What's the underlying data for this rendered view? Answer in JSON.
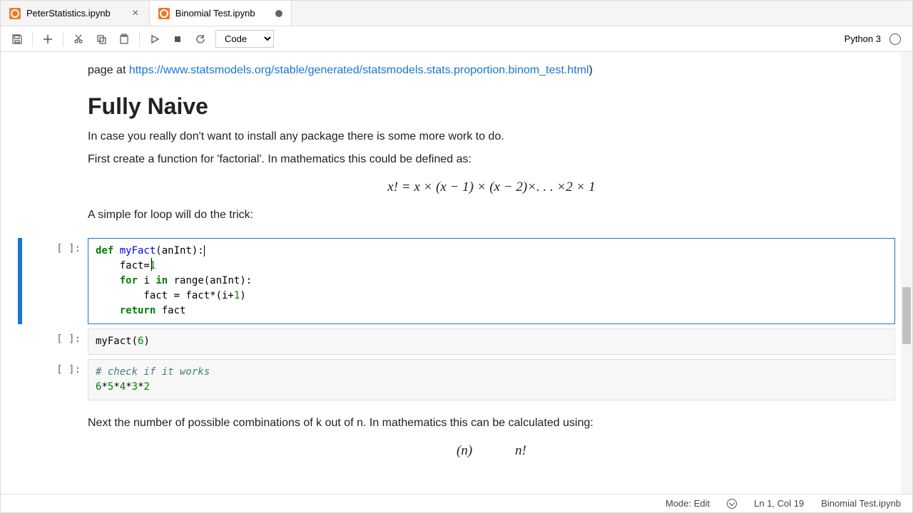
{
  "tabs": [
    {
      "label": "PeterStatistics.ipynb",
      "active": false,
      "dirty": false
    },
    {
      "label": "Binomial Test.ipynb",
      "active": true,
      "dirty": true
    }
  ],
  "toolbar": {
    "cell_type": "Code",
    "kernel_label": "Python 3"
  },
  "markdown": {
    "top_text_prefix": "page at ",
    "top_link": "https://www.statsmodels.org/stable/generated/statsmodels.stats.proportion.binom_test.html",
    "top_text_suffix": ")",
    "heading": "Fully Naive",
    "para1": "In case you really don't want to install any package there is some more work to do.",
    "para2": "First create a function for 'factorial'. In mathematics this could be defined as:",
    "formula": "x! = x × (x − 1) × (x − 2)×. . . ×2 × 1",
    "para3": "A simple for loop will do the trick:",
    "para4": "Next the number of possible combinations of k out of n. In mathematics this can be calculated using:",
    "formula2_left": "(n)",
    "formula2_right": "n!"
  },
  "cells": [
    {
      "prompt": "[ ]:",
      "active": true,
      "code_lines": [
        [
          {
            "t": "def ",
            "c": "tok-kw"
          },
          {
            "t": "myFact",
            "c": "tok-fn"
          },
          {
            "t": "(anInt):",
            "c": ""
          },
          {
            "cursor": true
          }
        ],
        [
          {
            "t": "    fact=",
            "c": ""
          },
          {
            "t": "1",
            "c": "tok-num"
          }
        ],
        [
          {
            "t": "    ",
            "c": ""
          },
          {
            "t": "for",
            "c": "tok-kw"
          },
          {
            "t": " i ",
            "c": ""
          },
          {
            "t": "in",
            "c": "tok-kw"
          },
          {
            "t": " range(anInt):",
            "c": ""
          }
        ],
        [
          {
            "t": "        fact = fact*(i+",
            "c": ""
          },
          {
            "t": "1",
            "c": "tok-num"
          },
          {
            "t": ")",
            "c": ""
          }
        ],
        [
          {
            "t": "    ",
            "c": ""
          },
          {
            "t": "return",
            "c": "tok-kw"
          },
          {
            "t": " fact",
            "c": ""
          }
        ]
      ]
    },
    {
      "prompt": "[ ]:",
      "active": false,
      "code_lines": [
        [
          {
            "t": "myFact(",
            "c": ""
          },
          {
            "t": "6",
            "c": "tok-num"
          },
          {
            "t": ")",
            "c": ""
          }
        ]
      ]
    },
    {
      "prompt": "[ ]:",
      "active": false,
      "code_lines": [
        [
          {
            "t": "# check if it works",
            "c": "tok-cmt"
          }
        ],
        [
          {
            "t": "6",
            "c": "tok-num"
          },
          {
            "t": "*",
            "c": ""
          },
          {
            "t": "5",
            "c": "tok-num"
          },
          {
            "t": "*",
            "c": ""
          },
          {
            "t": "4",
            "c": "tok-num"
          },
          {
            "t": "*",
            "c": ""
          },
          {
            "t": "3",
            "c": "tok-num"
          },
          {
            "t": "*",
            "c": ""
          },
          {
            "t": "2",
            "c": "tok-num"
          }
        ]
      ]
    }
  ],
  "statusbar": {
    "mode": "Mode: Edit",
    "cursor_pos": "Ln 1, Col 19",
    "filename": "Binomial Test.ipynb"
  }
}
